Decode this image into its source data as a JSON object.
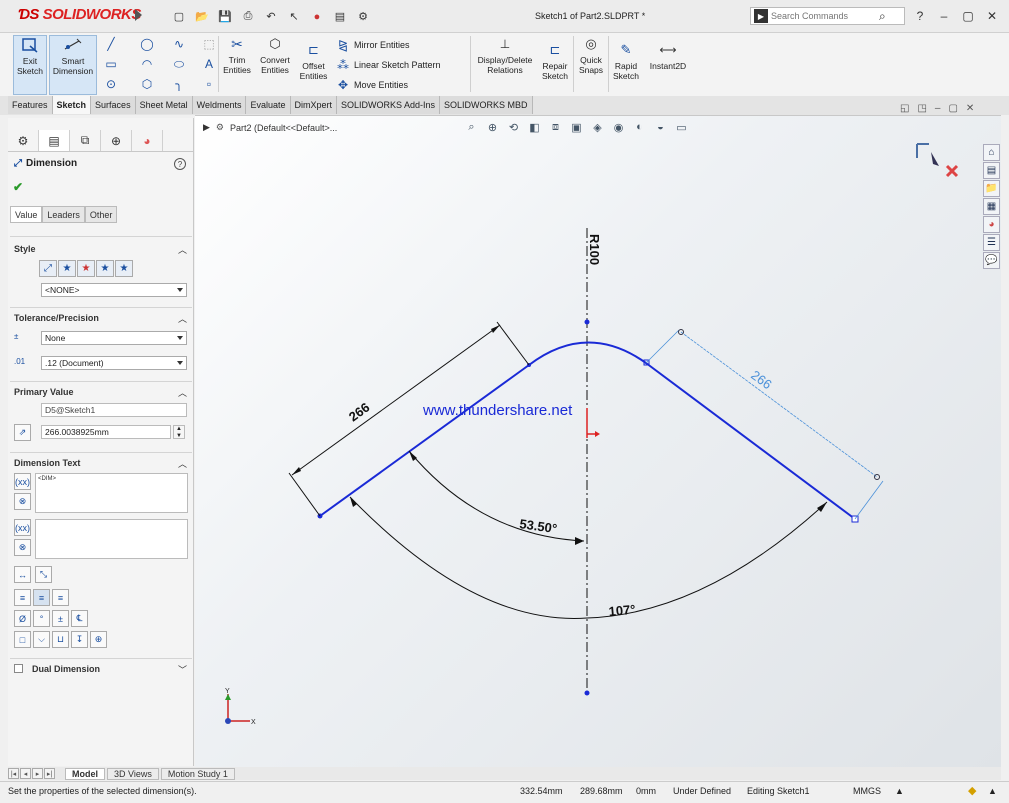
{
  "app": {
    "brand": "SOLIDWORKS",
    "doc_title": "Sketch1 of Part2.SLDPRT *"
  },
  "search": {
    "placeholder": "Search Commands"
  },
  "commands": {
    "exit_sketch": "Exit Sketch",
    "smart_dimension": "Smart Dimension",
    "trim_entities": "Trim Entities",
    "convert_entities": "Convert Entities",
    "offset_entities": "Offset Entities",
    "mirror_entities": "Mirror Entities",
    "linear_sketch_pattern": "Linear Sketch Pattern",
    "move_entities": "Move Entities",
    "display_delete_relations": "Display/Delete Relations",
    "repair_sketch": "Repair Sketch",
    "quick_snaps": "Quick Snaps",
    "rapid_sketch": "Rapid Sketch",
    "instant2d": "Instant2D"
  },
  "tabs": [
    "Features",
    "Sketch",
    "Surfaces",
    "Sheet Metal",
    "Weldments",
    "Evaluate",
    "DimXpert",
    "SOLIDWORKS Add-Ins",
    "SOLIDWORKS MBD"
  ],
  "property_manager": {
    "title": "Dimension",
    "subtabs": [
      "Value",
      "Leaders",
      "Other"
    ],
    "style_title": "Style",
    "style_select": "<NONE>",
    "tolerance_title": "Tolerance/Precision",
    "tolerance_value": "None",
    "precision_value": ".12 (Document)",
    "primary_title": "Primary Value",
    "primary_name": "D5@Sketch1",
    "primary_value": "266.0038925mm",
    "dim_text_title": "Dimension Text",
    "dim_text": "<DIM>",
    "dual_dimension": "Dual Dimension"
  },
  "viewport": {
    "breadcrumb": "Part2  (Default<<Default>...",
    "watermark": "www.thundershare.net"
  },
  "sketch_dims": {
    "radius": "R100",
    "left_length": "266",
    "right_length": "266",
    "half_angle": "53.50°",
    "full_angle": "107°"
  },
  "bottom_tabs": [
    "Model",
    "3D Views",
    "Motion Study 1"
  ],
  "status": {
    "message": "Set the properties of the selected dimension(s).",
    "x": "332.54mm",
    "y": "289.68mm",
    "z": "0mm",
    "state": "Under Defined",
    "editing": "Editing Sketch1",
    "units": "MMGS"
  },
  "colors": {
    "sketch_line": "#1a2ad6",
    "brand": "#c81e1e",
    "dim_line": "#111111",
    "selected_dim": "#4a90d9"
  }
}
